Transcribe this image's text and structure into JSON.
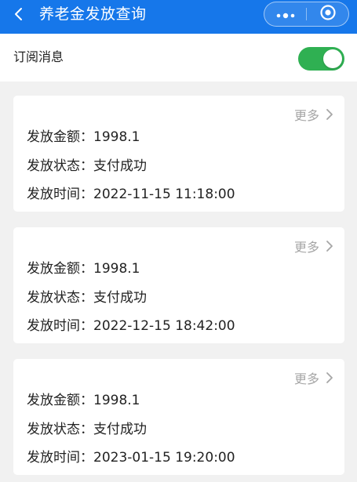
{
  "header": {
    "title": "养老金发放查询",
    "icons": {
      "back": "chevron-left-icon",
      "more": "more-dots-icon",
      "close": "target-close-icon"
    },
    "color": "#1677ea"
  },
  "subscription": {
    "label": "订阅消息",
    "toggle_on": true,
    "toggle_color": "#2fb052"
  },
  "records": [
    {
      "more_label": "更多",
      "amount_label": "发放金额",
      "amount": "1998.1",
      "status_label": "发放状态",
      "status": "支付成功",
      "time_label": "发放时间",
      "time": "2022-11-15 11:18:00"
    },
    {
      "more_label": "更多",
      "amount_label": "发放金额",
      "amount": "1998.1",
      "status_label": "发放状态",
      "status": "支付成功",
      "time_label": "发放时间",
      "time": "2022-12-15 18:42:00"
    },
    {
      "more_label": "更多",
      "amount_label": "发放金额",
      "amount": "1998.1",
      "status_label": "发放状态",
      "status": "支付成功",
      "time_label": "发放时间",
      "time": "2023-01-15 19:20:00"
    }
  ]
}
